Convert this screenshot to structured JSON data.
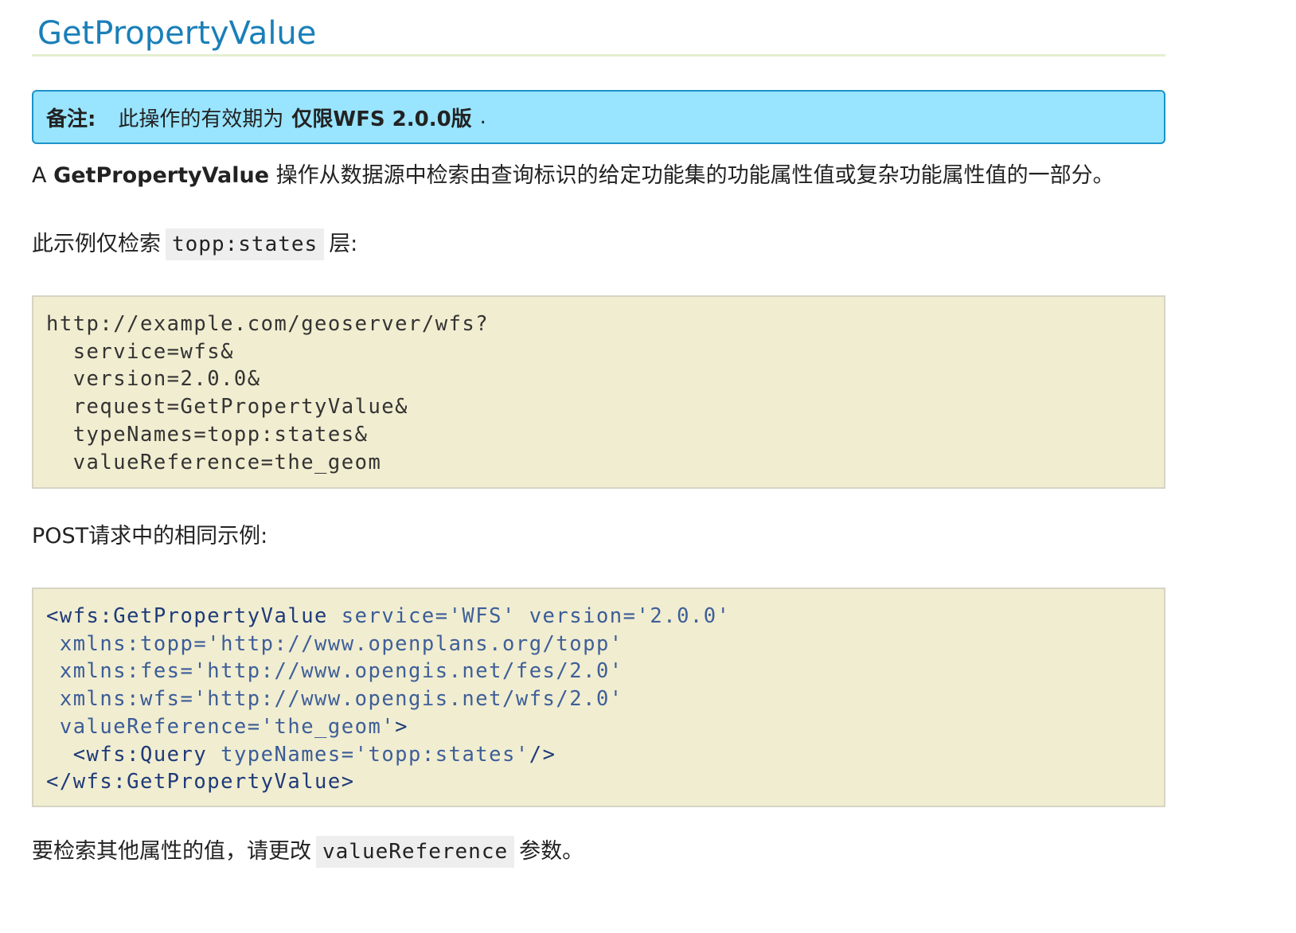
{
  "header": {
    "title": "GetPropertyValue"
  },
  "note": {
    "label": "备注:",
    "text_before": "此操作的有效期为",
    "text_strong": "仅限WFS 2.0.0版",
    "text_after": "."
  },
  "intro": {
    "prefix": "A",
    "term": "GetPropertyValue",
    "text": "操作从数据源中检索由查询标识的给定功能集的功能属性值或复杂功能属性值的一部分。"
  },
  "example_get": {
    "text_before": "此示例仅检索",
    "code": "topp:states",
    "text_after": "层:",
    "lines": [
      "http://example.com/geoserver/wfs?",
      "  service=wfs&",
      "  version=2.0.0&",
      "  request=GetPropertyValue&",
      "  typeNames=topp:states&",
      "  valueReference=the_geom"
    ]
  },
  "example_post": {
    "caption": "POST请求中的相同示例:",
    "lines": [
      [
        {
          "t": "tag",
          "v": "<wfs:GetPropertyValue"
        },
        {
          "t": "attr",
          "v": " service="
        },
        {
          "t": "str",
          "v": "'WFS'"
        },
        {
          "t": "attr",
          "v": " version="
        },
        {
          "t": "str",
          "v": "'2.0.0'"
        }
      ],
      [
        {
          "t": "attr",
          "v": " xmlns:topp="
        },
        {
          "t": "str",
          "v": "'http://www.openplans.org/topp'"
        }
      ],
      [
        {
          "t": "attr",
          "v": " xmlns:fes="
        },
        {
          "t": "str",
          "v": "'http://www.opengis.net/fes/2.0'"
        }
      ],
      [
        {
          "t": "attr",
          "v": " xmlns:wfs="
        },
        {
          "t": "str",
          "v": "'http://www.opengis.net/wfs/2.0'"
        }
      ],
      [
        {
          "t": "attr",
          "v": " valueReference="
        },
        {
          "t": "str",
          "v": "'the_geom'"
        },
        {
          "t": "tag",
          "v": ">"
        }
      ],
      [
        {
          "t": "tag",
          "v": "  <wfs:Query"
        },
        {
          "t": "attr",
          "v": " typeNames="
        },
        {
          "t": "str",
          "v": "'topp:states'"
        },
        {
          "t": "tag",
          "v": "/>"
        }
      ],
      [
        {
          "t": "tag",
          "v": "</wfs:GetPropertyValue>"
        }
      ]
    ]
  },
  "outro": {
    "text_before": "要检索其他属性的值，请更改",
    "code": "valueReference",
    "text_after": "参数。"
  }
}
